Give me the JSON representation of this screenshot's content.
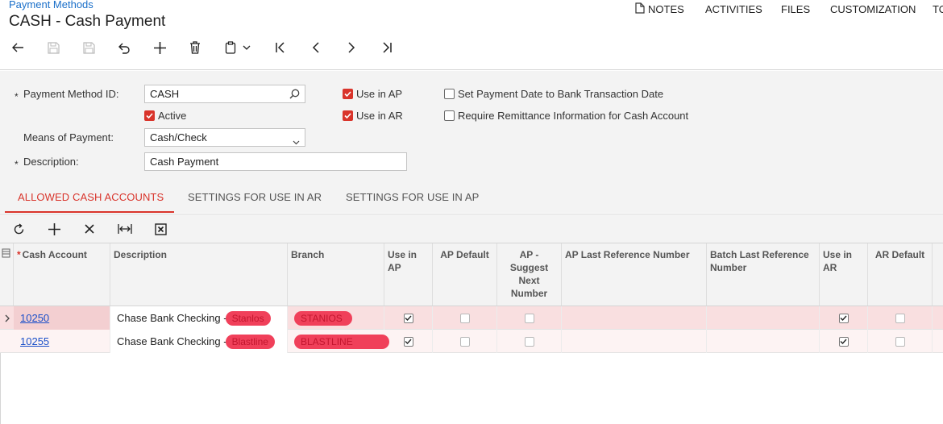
{
  "breadcrumb": "Payment Methods",
  "title": "CASH - Cash Payment",
  "top_links": [
    {
      "label": "NOTES",
      "icon": "document-icon"
    },
    {
      "label": "ACTIVITIES"
    },
    {
      "label": "FILES"
    },
    {
      "label": "CUSTOMIZATION"
    },
    {
      "label": "TO"
    }
  ],
  "toolbar_icons": [
    "back-arrow-icon",
    "save-close-icon",
    "save-icon",
    "undo-icon",
    "add-icon",
    "delete-icon",
    "clipboard-icon",
    "chevron-down-icon",
    "first-record-icon",
    "prev-record-icon",
    "next-record-icon",
    "last-record-icon"
  ],
  "form": {
    "payment_method_id_label": "Payment Method ID:",
    "payment_method_id_value": "CASH",
    "active_label": "Active",
    "means_label": "Means of Payment:",
    "means_value": "Cash/Check",
    "description_label": "Description:",
    "description_value": "Cash Payment",
    "use_in_ap_label": "Use in AP",
    "use_in_ar_label": "Use in AR",
    "set_payment_date_label": "Set Payment Date to Bank Transaction Date",
    "require_remittance_label": "Require Remittance Information for Cash Account",
    "checks": {
      "active": true,
      "use_in_ap": true,
      "use_in_ar": true,
      "set_payment_date": false,
      "require_remittance": false
    }
  },
  "tabs": [
    {
      "label": "ALLOWED CASH ACCOUNTS",
      "active": true
    },
    {
      "label": "SETTINGS FOR USE IN AR",
      "active": false
    },
    {
      "label": "SETTINGS FOR USE IN AP",
      "active": false
    }
  ],
  "grid_toolbar_icons": [
    "refresh-icon",
    "add-row-icon",
    "delete-row-icon",
    "fit-columns-icon",
    "export-excel-icon"
  ],
  "columns": [
    {
      "key": "cash_account",
      "label": "Cash Account",
      "required": true
    },
    {
      "key": "description",
      "label": "Description"
    },
    {
      "key": "branch",
      "label": "Branch"
    },
    {
      "key": "use_in_ap",
      "label": "Use in AP"
    },
    {
      "key": "ap_default",
      "label": "AP Default"
    },
    {
      "key": "ap_suggest",
      "label": "AP - Suggest Next Number"
    },
    {
      "key": "ap_last_ref",
      "label": "AP Last Reference Number"
    },
    {
      "key": "batch_last_ref",
      "label": "Batch Last Reference Number"
    },
    {
      "key": "use_in_ar",
      "label": "Use in AR"
    },
    {
      "key": "ar_default",
      "label": "AR Default"
    }
  ],
  "rows": [
    {
      "cash_account": "10250",
      "description": "Chase Bank Checking -",
      "desc_redacted": "Stanlos",
      "branch": "STANIOS",
      "use_in_ap": true,
      "ap_default": false,
      "ap_suggest": false,
      "use_in_ar": true,
      "ar_default": false
    },
    {
      "cash_account": "10255",
      "description": "Chase Bank Checking -",
      "desc_redacted": "Blastline",
      "branch": "BLASTLINE",
      "use_in_ap": true,
      "ap_default": false,
      "ap_suggest": false,
      "use_in_ar": true,
      "ar_default": false
    }
  ],
  "colors": {
    "accent": "#d9342b",
    "link": "#1a6fc9",
    "redaction": "#f0405a",
    "row_selected": "#f9dfe0"
  }
}
